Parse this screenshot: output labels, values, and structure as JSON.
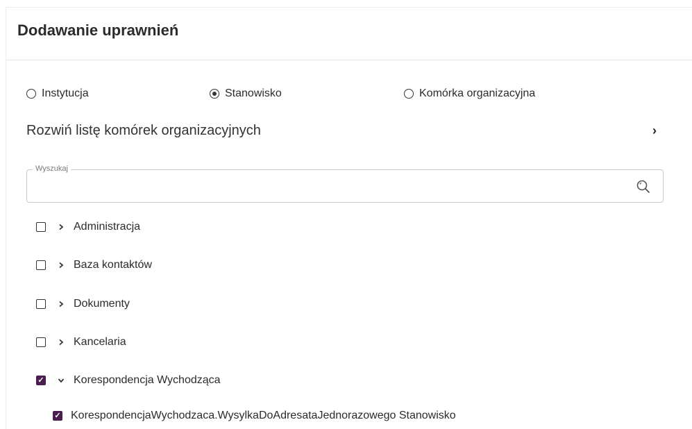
{
  "dialog": {
    "title": "Dodawanie uprawnień"
  },
  "scope_options": [
    {
      "label": "Instytucja",
      "selected": false
    },
    {
      "label": "Stanowisko",
      "selected": true
    },
    {
      "label": "Komórka organizacyjna",
      "selected": false
    }
  ],
  "expand_section": {
    "label": "Rozwiń listę komórek organizacyjnych",
    "chevron": "›"
  },
  "search": {
    "legend": "Wyszukaj",
    "value": "",
    "icon": "search-icon"
  },
  "tree": {
    "items": [
      {
        "label": "Administracja",
        "checked": false,
        "expanded": false
      },
      {
        "label": "Baza kontaktów",
        "checked": false,
        "expanded": false
      },
      {
        "label": "Dokumenty",
        "checked": false,
        "expanded": false
      },
      {
        "label": "Kancelaria",
        "checked": false,
        "expanded": false
      },
      {
        "label": "Korespondencja Wychodząca",
        "checked": true,
        "expanded": true
      },
      {
        "label": "KorespondencjaWychodzaca.WysylkaDoAdresataJednorazowego Stanowisko",
        "checked": true,
        "child": true
      }
    ]
  },
  "colors": {
    "accent": "#4a1e4f",
    "text": "#2b2b2b"
  }
}
